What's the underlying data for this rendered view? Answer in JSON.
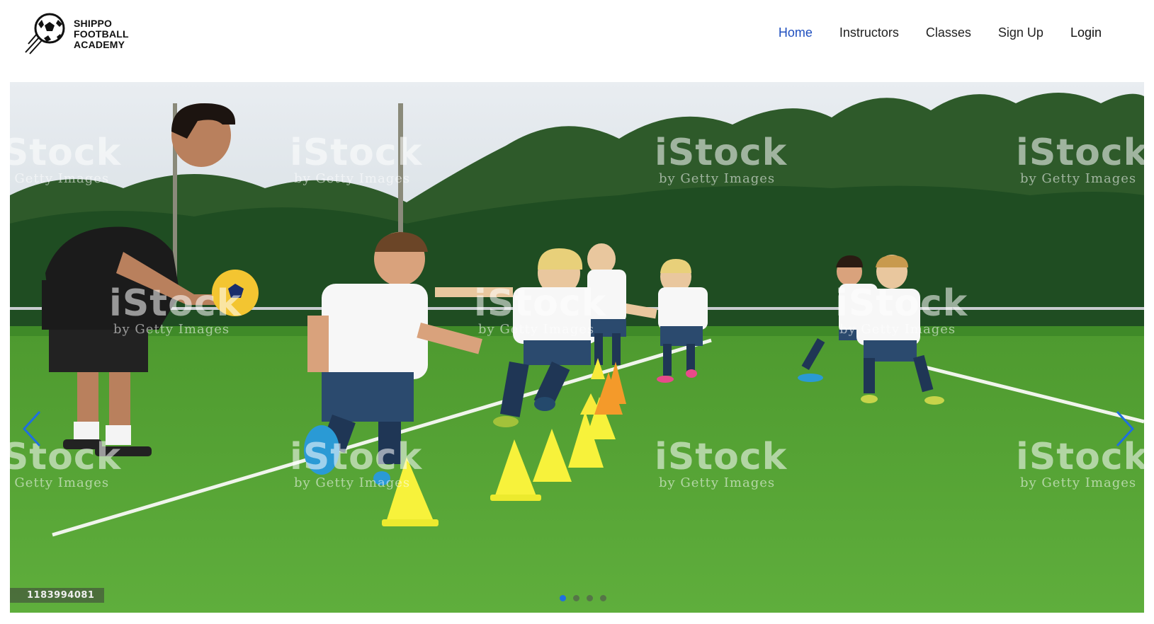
{
  "brand": {
    "line1": "SHIPPO",
    "line2": "FOOTBALL",
    "line3": "ACADEMY",
    "logo_icon": "soccer-ball-icon"
  },
  "nav": {
    "items": [
      {
        "label": "Home",
        "active": true
      },
      {
        "label": "Instructors",
        "active": false
      },
      {
        "label": "Classes",
        "active": false
      },
      {
        "label": "Sign Up",
        "active": false
      },
      {
        "label": "Login",
        "active": false
      }
    ]
  },
  "carousel": {
    "image_id": "1183994081",
    "watermark": {
      "brand": "iStock",
      "sub": "by Getty Images"
    },
    "slide_count": 4,
    "active_slide": 1,
    "prev_icon": "chevron-left-icon",
    "next_icon": "chevron-right-icon"
  },
  "colors": {
    "accent": "#1f4fbf",
    "indicator_active": "#1f6fe0",
    "grass": "#5aa03a",
    "sky": "#dfe6ec",
    "hedge": "#1f4d22"
  }
}
